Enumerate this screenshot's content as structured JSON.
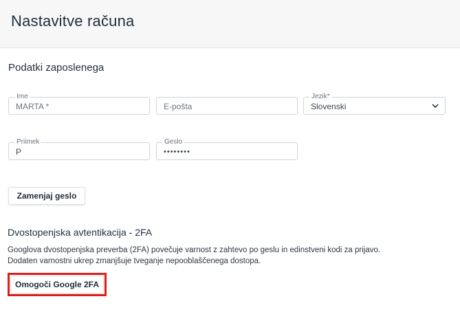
{
  "header": {
    "title": "Nastavitve računa"
  },
  "employee": {
    "section_title": "Podatki zaposlenega",
    "name": {
      "label": "Ime",
      "value": "MARTA *"
    },
    "email": {
      "placeholder": "E-pošta"
    },
    "language": {
      "label": "Jezik*",
      "value": "Slovenski"
    },
    "surname": {
      "label": "Priimek",
      "value": "P"
    },
    "password": {
      "label": "Geslo",
      "value": "••••••••"
    },
    "change_password_label": "Zamenjaj geslo"
  },
  "twofa": {
    "title": "Dvostopenjska avtentikacija - 2FA",
    "description_line1": "Googlova dvostopenjska preverba (2FA) povečuje varnost z zahtevo po geslu in edinstveni kodi za prijavo.",
    "description_line2": "Dodaten varnostni ukrep zmanjšuje tveganje nepooblaščenega dostopa.",
    "enable_button_label": "Omogoči Google 2FA"
  },
  "colors": {
    "highlight": "#e41b1b",
    "text": "#1f2d3d"
  },
  "icons": {
    "language_dropdown": "chevron-down-icon"
  }
}
